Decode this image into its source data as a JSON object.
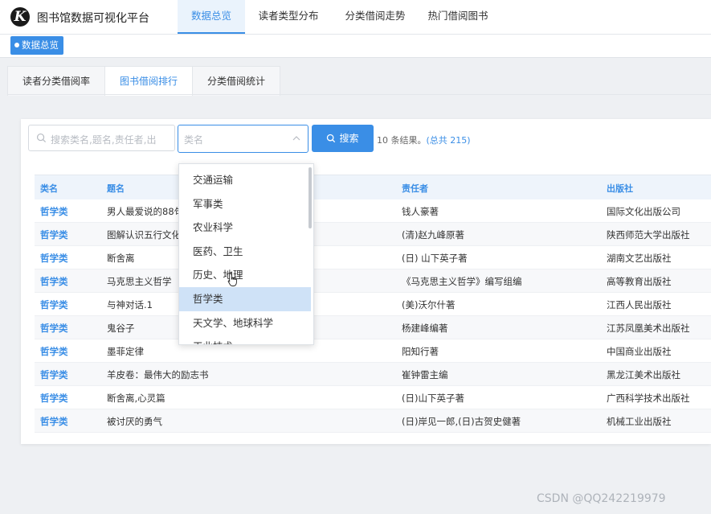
{
  "header": {
    "logo": "K",
    "title": "图书馆数据可视化平台",
    "nav": [
      "数据总览",
      "读者类型分布",
      "分类借阅走势",
      "热门借阅图书"
    ]
  },
  "breadcrumb": {
    "tag": "数据总览"
  },
  "subtabs": [
    "读者分类借阅率",
    "图书借阅排行",
    "分类借阅统计"
  ],
  "search": {
    "placeholder": "搜索类名,题名,责任者,出",
    "select_placeholder": "类名",
    "button": "搜索",
    "result_prefix": "10 条结果。",
    "result_total": "(总共 215)"
  },
  "table": {
    "headers": [
      "类名",
      "题名",
      "责任者",
      "出版社"
    ],
    "rows": [
      [
        "哲学类",
        "男人最爱说的88句",
        "钱人豪著",
        "国际文化出版公司"
      ],
      [
        "哲学类",
        "图解认识五行文化",
        "(清)赵九峰原著",
        "陕西师范大学出版社"
      ],
      [
        "哲学类",
        "断舍离",
        "(日) 山下英子著",
        "湖南文艺出版社"
      ],
      [
        "哲学类",
        "马克思主义哲学",
        "《马克思主义哲学》编写组编",
        "高等教育出版社"
      ],
      [
        "哲学类",
        "与神对话.1",
        "(美)沃尔什著",
        "江西人民出版社"
      ],
      [
        "哲学类",
        "鬼谷子",
        "杨建峰编著",
        "江苏凤凰美术出版社"
      ],
      [
        "哲学类",
        "墨菲定律",
        "阳知行著",
        "中国商业出版社"
      ],
      [
        "哲学类",
        "羊皮卷：最伟大的励志书",
        "崔钟雷主编",
        "黑龙江美术出版社"
      ],
      [
        "哲学类",
        "断舍离,心灵篇",
        "(日)山下英子著",
        "广西科学技术出版社"
      ],
      [
        "哲学类",
        "被讨厌的勇气",
        "(日)岸见一郎,(日)古贺史健著",
        "机械工业出版社"
      ]
    ]
  },
  "dropdown": {
    "options": [
      "交通运输",
      "军事类",
      "农业科学",
      "医药、卫生",
      "历史、地理",
      "哲学类",
      "天文学、地球科学",
      "工业技术"
    ],
    "highlighted": "哲学类"
  },
  "watermark": "CSDN @QQ242219979",
  "colors": {
    "accent": "#3a8ee6",
    "highlight": "#cfe2f7"
  }
}
